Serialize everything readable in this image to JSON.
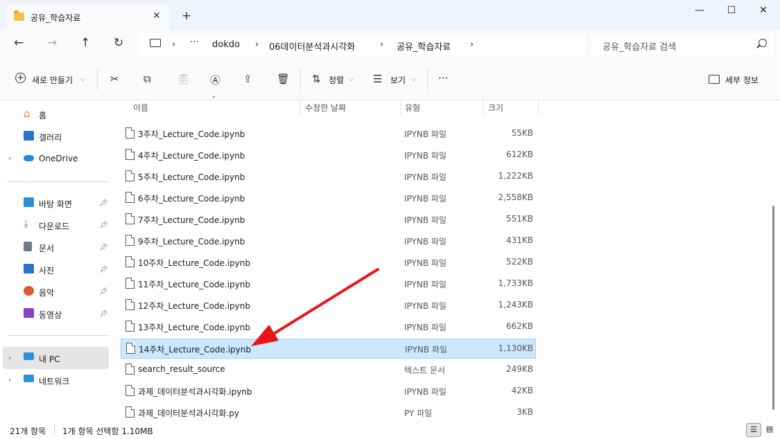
{
  "window": {
    "tab_title": "공유_학습자료",
    "tab_close": "✕",
    "new_tab": "+",
    "minimize": "—",
    "maximize": "☐",
    "close": "✕"
  },
  "address": {
    "back": "←",
    "forward": "→",
    "up": "↑",
    "refresh": "↻",
    "more": "···",
    "crumbs": [
      "dokdo",
      "06데이터분석과시각화",
      "공유_학습자료"
    ],
    "search_placeholder": "공유_학습자료 검색"
  },
  "commands": {
    "new": "새로 만들기",
    "sort": "정렬",
    "view": "보기",
    "more": "···",
    "details": "세부 정보"
  },
  "sidebar": {
    "top": [
      {
        "label": "홈",
        "icon": "home-icon"
      },
      {
        "label": "갤러리",
        "icon": "gallery-icon"
      },
      {
        "label": "OneDrive",
        "icon": "onedrive-icon"
      }
    ],
    "pinned": [
      {
        "label": "바탕 화면",
        "icon": "desktop-icon"
      },
      {
        "label": "다운로드",
        "icon": "download-icon"
      },
      {
        "label": "문서",
        "icon": "documents-icon"
      },
      {
        "label": "사진",
        "icon": "pictures-icon"
      },
      {
        "label": "음악",
        "icon": "music-icon"
      },
      {
        "label": "동영상",
        "icon": "videos-icon"
      }
    ],
    "bottom": [
      {
        "label": "내 PC",
        "icon": "pc-icon"
      },
      {
        "label": "네트워크",
        "icon": "network-icon"
      }
    ]
  },
  "columns": {
    "name": "이름",
    "modified": "수정한 날짜",
    "type": "유형",
    "size": "크기"
  },
  "files": [
    {
      "name": "3주차_Lecture_Code.ipynb",
      "type": "IPYNB 파일",
      "size": "55KB",
      "selected": false
    },
    {
      "name": "4주차_Lecture_Code.ipynb",
      "type": "IPYNB 파일",
      "size": "612KB",
      "selected": false
    },
    {
      "name": "5주차_Lecture_Code.ipynb",
      "type": "IPYNB 파일",
      "size": "1,222KB",
      "selected": false
    },
    {
      "name": "6주차_Lecture_Code.ipynb",
      "type": "IPYNB 파일",
      "size": "2,558KB",
      "selected": false
    },
    {
      "name": "7주차_Lecture_Code.ipynb",
      "type": "IPYNB 파일",
      "size": "551KB",
      "selected": false
    },
    {
      "name": "9주차_Lecture_Code.ipynb",
      "type": "IPYNB 파일",
      "size": "431KB",
      "selected": false
    },
    {
      "name": "10주차_Lecture_Code.ipynb",
      "type": "IPYNB 파일",
      "size": "522KB",
      "selected": false
    },
    {
      "name": "11주차_Lecture_Code.ipynb",
      "type": "IPYNB 파일",
      "size": "1,733KB",
      "selected": false
    },
    {
      "name": "12주차_Lecture_Code.ipynb",
      "type": "IPYNB 파일",
      "size": "1,243KB",
      "selected": false
    },
    {
      "name": "13주차_Lecture_Code.ipynb",
      "type": "IPYNB 파일",
      "size": "662KB",
      "selected": false
    },
    {
      "name": "14주차_Lecture_Code.ipynb",
      "type": "IPYNB 파일",
      "size": "1,130KB",
      "selected": true
    },
    {
      "name": "search_result_source",
      "type": "텍스트 문서",
      "size": "249KB",
      "selected": false
    },
    {
      "name": "과제_데이터분석과시각화.ipynb",
      "type": "IPYNB 파일",
      "size": "42KB",
      "selected": false
    },
    {
      "name": "과제_데이터분석과시각화.py",
      "type": "PY 파일",
      "size": "3KB",
      "selected": false
    }
  ],
  "status": {
    "count": "21개 항목",
    "selection": "1개 항목 선택함 1.10MB"
  },
  "colors": {
    "accent": "#0067c0",
    "selection": "#cce8ff",
    "arrow": "#e8161b"
  }
}
